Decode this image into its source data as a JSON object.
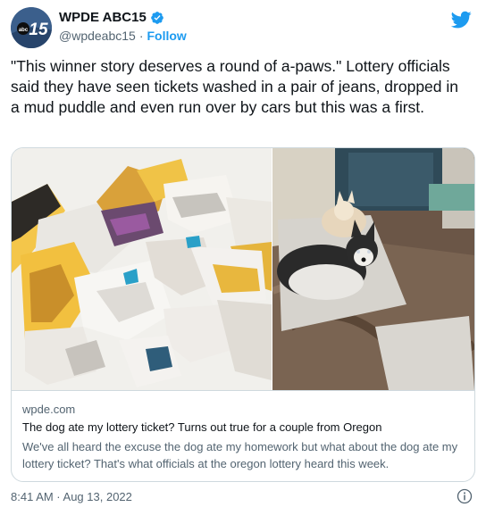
{
  "account": {
    "name": "WPDE ABC15",
    "handle": "@wpdeabc15",
    "separator": "·",
    "follow_label": "Follow",
    "avatar_text": "abc15"
  },
  "tweet": {
    "text": "\"This winner story deserves a round of a-paws.\" Lottery officials said they have seen tickets washed in a pair of jeans, dropped in a mud puddle and even run over by cars but this was a first."
  },
  "link_card": {
    "domain": "wpde.com",
    "title": "The dog ate my lottery ticket? Turns out true for a couple from Oregon",
    "description": "We've all heard the excuse the dog ate my homework but what about the dog ate my lottery ticket? That's what officials at the oregon lottery heard this week."
  },
  "footer": {
    "timestamp": "8:41 AM · Aug 13, 2022"
  },
  "colors": {
    "accent": "#1d9bf0",
    "text_primary": "#0f1419",
    "text_secondary": "#536471",
    "border": "#cfd9de"
  },
  "icons": {
    "verified": "verified-badge-icon",
    "brand": "twitter-bird-icon",
    "info": "info-icon"
  }
}
